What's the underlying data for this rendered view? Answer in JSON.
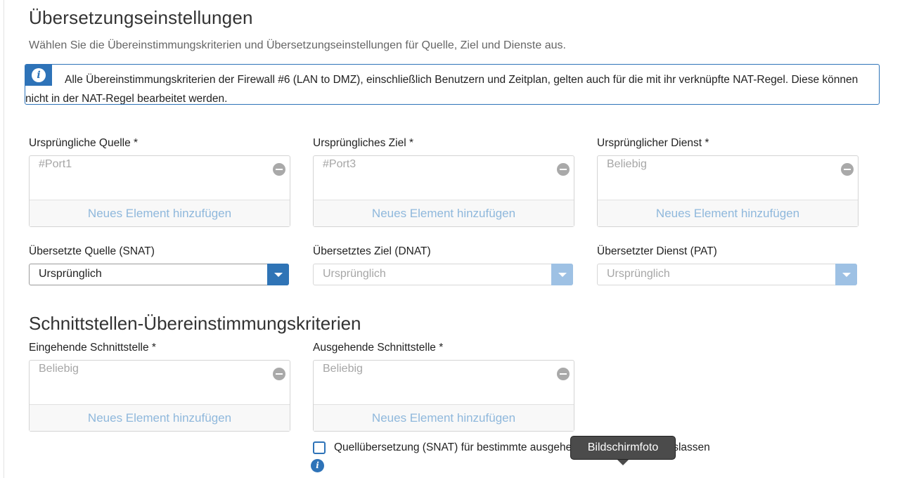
{
  "section1": {
    "title": "Übersetzungseinstellungen",
    "subtitle": "Wählen Sie die Übereinstimmungskriterien und Übersetzungseinstellungen für Quelle, Ziel und Dienste aus.",
    "info": "Alle Übereinstimmungskriterien der Firewall #6 (LAN to DMZ), einschließlich Benutzern und Zeitplan, gelten auch für die mit ihr verknüpfte NAT-Regel. Diese können nicht in der NAT-Regel bearbeitet werden."
  },
  "original": {
    "source": {
      "label": "Ursprüngliche Quelle *",
      "value": "#Port1",
      "add": "Neues Element hinzufügen"
    },
    "destination": {
      "label": "Ursprüngliches Ziel *",
      "value": "#Port3",
      "add": "Neues Element hinzufügen"
    },
    "service": {
      "label": "Ursprünglicher Dienst *",
      "value": "Beliebig",
      "add": "Neues Element hinzufügen"
    }
  },
  "translated": {
    "source": {
      "label": "Übersetzte Quelle (SNAT)",
      "value": "Ursprünglich"
    },
    "destination": {
      "label": "Übersetztes Ziel (DNAT)",
      "value": "Ursprünglich"
    },
    "service": {
      "label": "Übersetzter Dienst (PAT)",
      "value": "Ursprünglich"
    }
  },
  "section2": {
    "title": "Schnittstellen-Übereinstimmungskriterien",
    "inbound": {
      "label": "Eingehende Schnittstelle *",
      "value": "Beliebig",
      "add": "Neues Element hinzufügen"
    },
    "outbound": {
      "label": "Ausgehende Schnittstelle *",
      "value": "Beliebig",
      "add": "Neues Element hinzufügen"
    },
    "checkbox_label": "Quellübersetzung (SNAT) für bestimmte ausgehende Schnittstellen auslassen",
    "checked": false
  },
  "tooltip": "Bildschirmfoto",
  "colors": {
    "accent": "#2e73b8",
    "accent_light": "#9ec1e4",
    "link_muted": "#8fb8dc",
    "tooltip_bg": "#4b4b4b"
  },
  "icons": [
    "info-icon",
    "remove-icon",
    "dropdown-caret-icon"
  ]
}
